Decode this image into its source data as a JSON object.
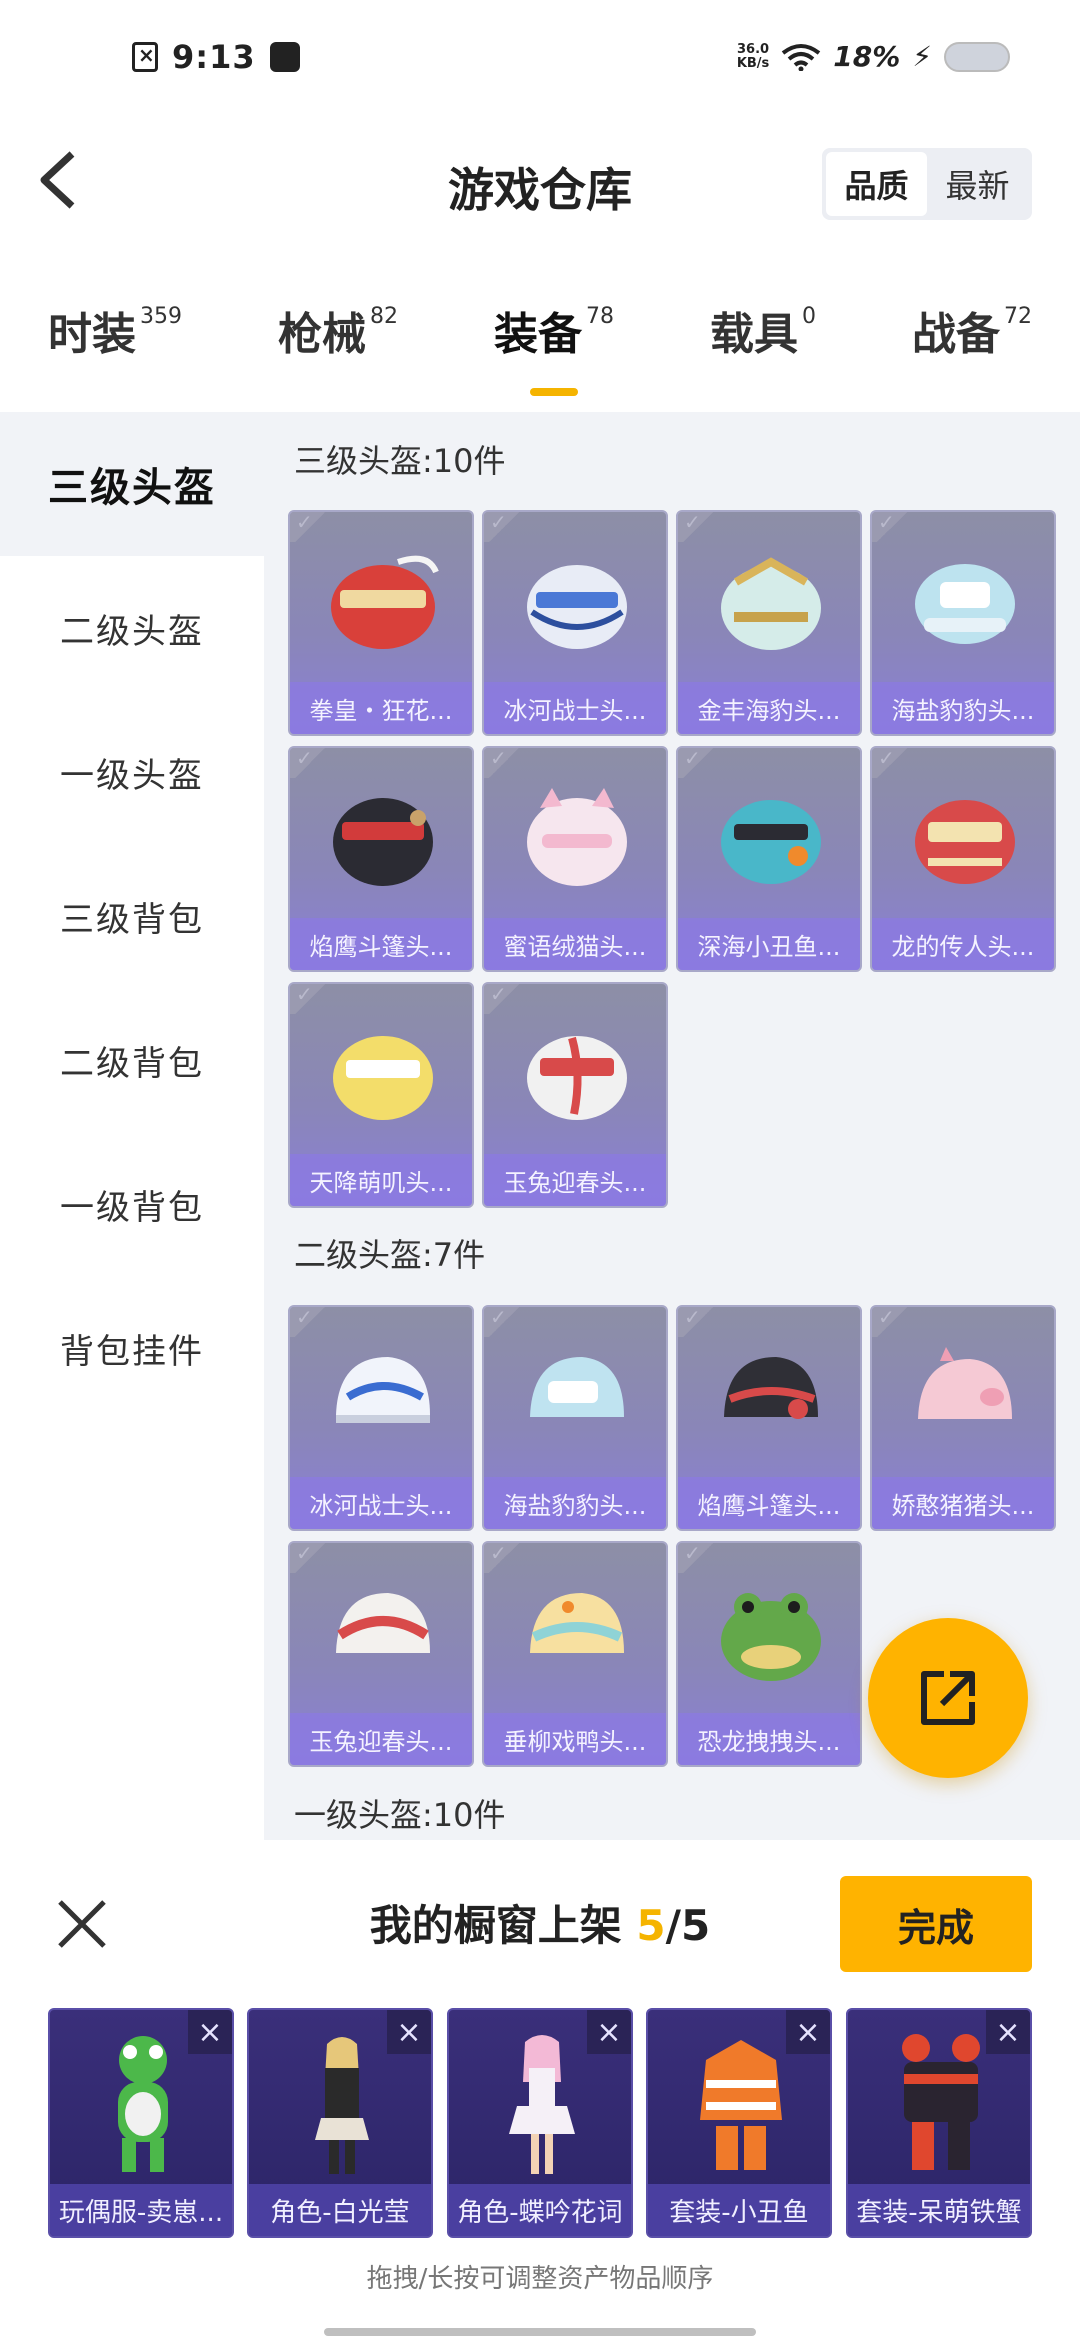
{
  "status_bar": {
    "time": "9:13",
    "speed_top": "36.0",
    "speed_bottom": "KB/s",
    "battery": "18%"
  },
  "header": {
    "title": "游戏仓库",
    "sort_options": [
      "品质",
      "最新"
    ],
    "sort_active": "品质"
  },
  "tabs": [
    {
      "label": "时装",
      "count": "359"
    },
    {
      "label": "枪械",
      "count": "82"
    },
    {
      "label": "装备",
      "count": "78"
    },
    {
      "label": "载具",
      "count": "0"
    },
    {
      "label": "战备",
      "count": "72"
    }
  ],
  "active_tab": "装备",
  "sidebar": {
    "items": [
      "三级头盔",
      "二级头盔",
      "一级头盔",
      "三级背包",
      "二级背包",
      "一级背包",
      "背包挂件"
    ],
    "active": "三级头盔"
  },
  "sections": [
    {
      "title": "三级头盔:10件",
      "items": [
        "拳皇・狂花...",
        "冰河战士头...",
        "金丰海豹头...",
        "海盐豹豹头...",
        "焰鹰斗篷头...",
        "蜜语绒猫头...",
        "深海小丑鱼...",
        "龙的传人头...",
        "天降萌叽头...",
        "玉兔迎春头..."
      ]
    },
    {
      "title": "二级头盔:7件",
      "items": [
        "冰河战士头...",
        "海盐豹豹头...",
        "焰鹰斗篷头...",
        "娇憨猪猪头...",
        "玉兔迎春头...",
        "垂柳戏鸭头...",
        "恐龙拽拽头..."
      ]
    },
    {
      "title": "一级头盔:10件",
      "items": []
    }
  ],
  "sheet": {
    "title_prefix": "我的橱窗上架 ",
    "current": "5",
    "total": "/5",
    "done_label": "完成",
    "items": [
      "玩偶服-卖崽...",
      "角色-白光莹",
      "角色-蝶吟花词",
      "套装-小丑鱼",
      "套装-呆萌铁蟹"
    ],
    "hint": "拖拽/长按可调整资产物品顺序"
  },
  "colors": {
    "accent": "#ffb300",
    "tab_underline": "#f5b400",
    "card_label": "#8c78e6",
    "shelf_card": "#2b2466"
  }
}
